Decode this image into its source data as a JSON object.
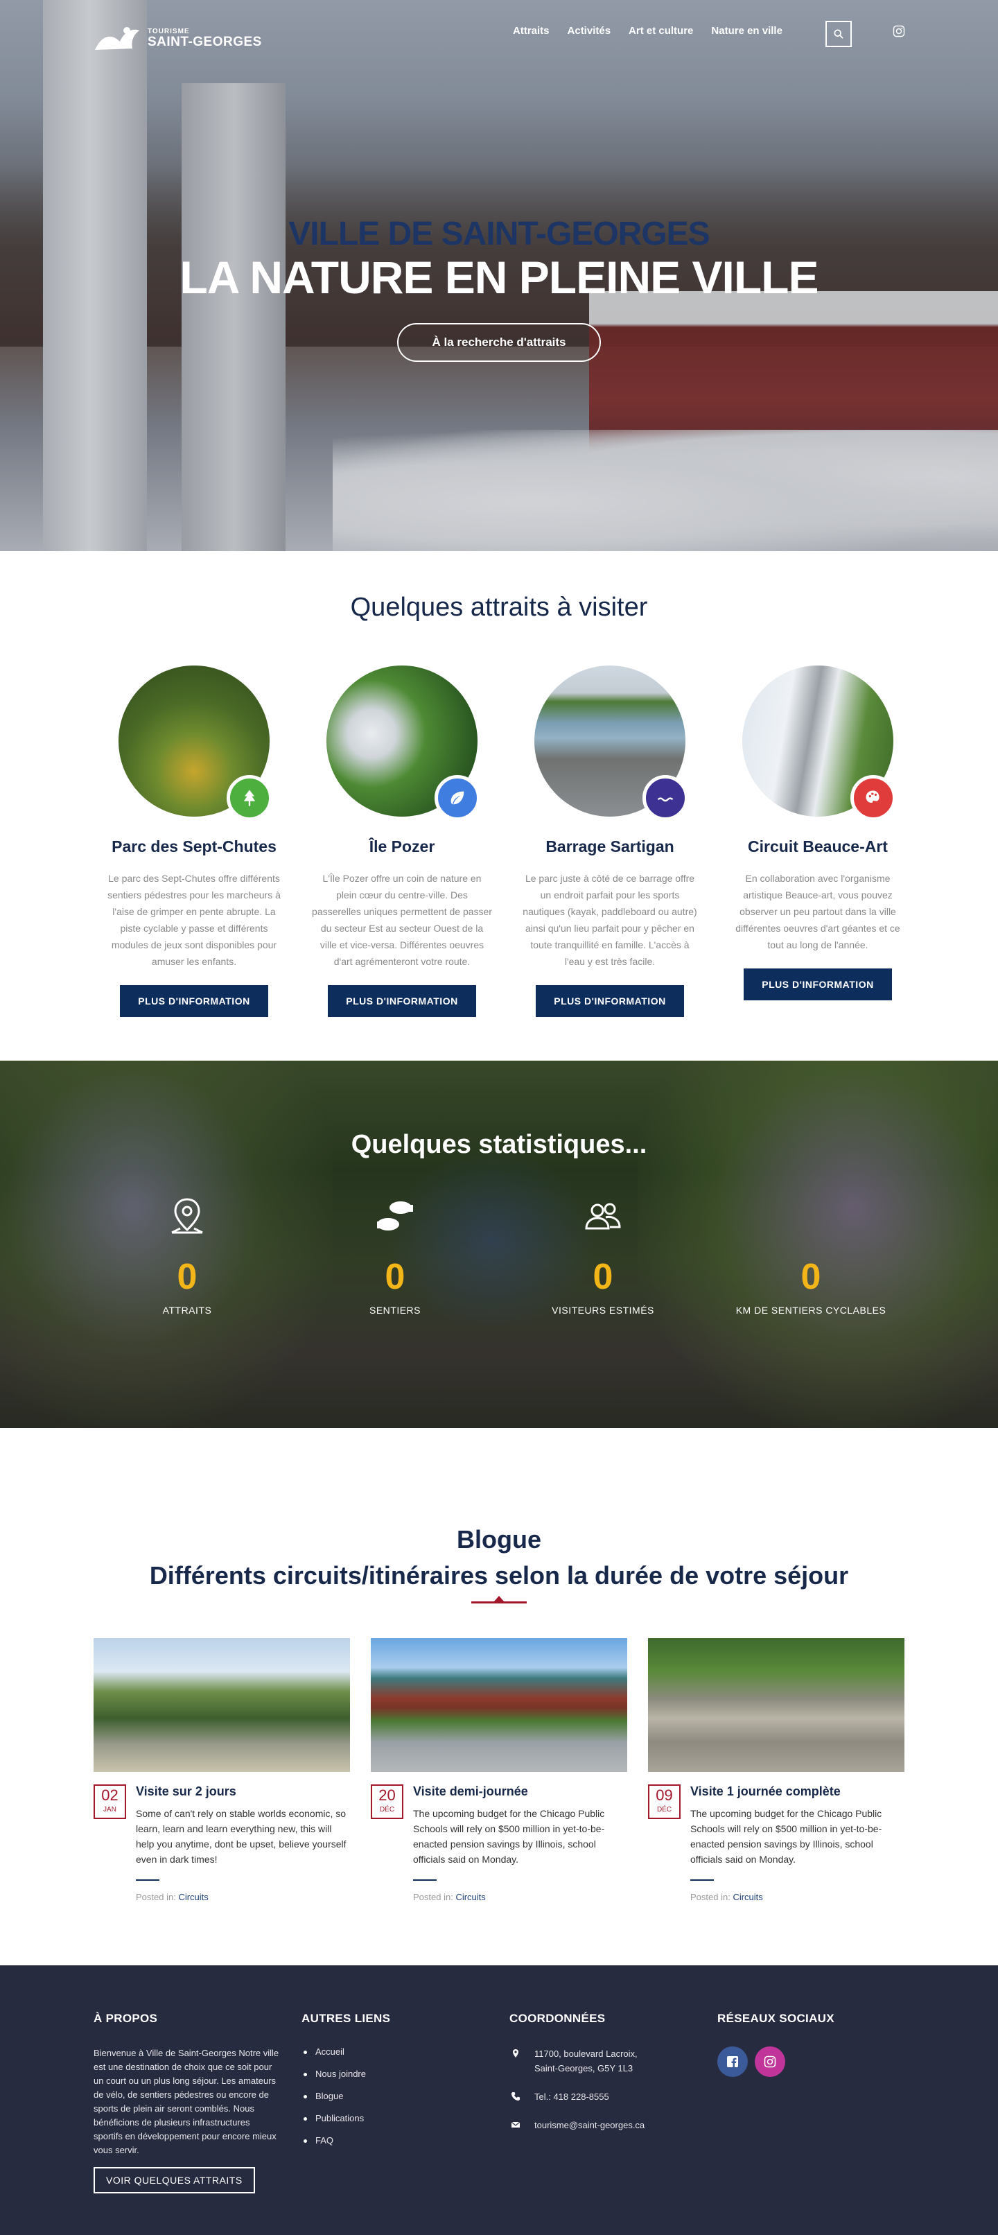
{
  "brand": {
    "top": "TOURISME",
    "name": "SAINT-GEORGES"
  },
  "nav": {
    "items": [
      "Attraits",
      "Activités",
      "Art et culture",
      "Nature en ville"
    ]
  },
  "hero": {
    "kicker": "VILLE DE SAINT-GEORGES",
    "title": "LA NATURE EN PLEINE VILLE",
    "cta": "À la recherche d'attraits"
  },
  "attractions": {
    "heading": "Quelques attraits à visiter",
    "button_label": "PLUS D'INFORMATION",
    "items": [
      {
        "title": "Parc des Sept-Chutes",
        "text": "Le parc des Sept-Chutes offre différents sentiers pédestres pour les marcheurs à l'aise de grimper en pente abrupte. La piste cyclable y passe et différents modules de jeux sont disponibles pour amuser les enfants.",
        "icon": "tree-icon",
        "badge_color": "#4caf3e"
      },
      {
        "title": "Île Pozer",
        "text": "L'Île Pozer offre un coin de nature en plein cœur du centre-ville. Des passerelles uniques permettent de passer du secteur Est au secteur Ouest de la ville et vice-versa. Différentes oeuvres d'art agrémenteront votre route.",
        "icon": "leaf-icon",
        "badge_color": "#3f7de0"
      },
      {
        "title": "Barrage Sartigan",
        "text": "Le parc juste à côté de ce barrage offre un endroit parfait pour les sports nautiques (kayak, paddleboard ou autre) ainsi qu'un lieu parfait pour y pêcher en toute tranquillité en famille. L'accès à l'eau y est très facile.",
        "icon": "water-icon",
        "badge_color": "#3d3193"
      },
      {
        "title": "Circuit Beauce-Art",
        "text": "En collaboration avec l'organisme artistique Beauce-art, vous pouvez observer un peu partout dans la ville différentes oeuvres d'art géantes et ce tout au long de l'année.",
        "icon": "palette-icon",
        "badge_color": "#e03c3c"
      }
    ]
  },
  "stats": {
    "heading": "Quelques statistiques...",
    "items": [
      {
        "value": "0",
        "label": "ATTRAITS",
        "icon": "map-pin-icon"
      },
      {
        "value": "0",
        "label": "SENTIERS",
        "icon": "footprints-icon"
      },
      {
        "value": "0",
        "label": "VISITEURS ESTIMÉS",
        "icon": "people-icon"
      },
      {
        "value": "0",
        "label": "KM DE SENTIERS CYCLABLES",
        "icon": "bike-icon"
      }
    ]
  },
  "blog": {
    "kicker": "Blogue",
    "title": "Différents circuits/itinéraires selon la durée de votre séjour",
    "posted_in": "Posted in:",
    "posts": [
      {
        "day": "02",
        "month": "JAN",
        "title": "Visite sur 2 jours",
        "text": "Some of can't rely on stable worlds economic, so learn, learn and learn everything new, this will help you anytime, dont be upset, believe yourself even in dark times!",
        "category": "Circuits"
      },
      {
        "day": "20",
        "month": "DÉC",
        "title": "Visite demi-journée",
        "text": "The upcoming budget for the Chicago Public Schools will rely on $500 million in yet-to-be-enacted pension savings by Illinois, school officials said on Monday.",
        "category": "Circuits"
      },
      {
        "day": "09",
        "month": "DÉC",
        "title": "Visite 1 journée complète",
        "text": "The upcoming budget for the Chicago Public Schools will rely on $500 million in yet-to-be-enacted pension savings by Illinois, school officials said on Monday.",
        "category": "Circuits"
      }
    ]
  },
  "footer": {
    "about": {
      "heading": "À PROPOS",
      "text": "Bienvenue à Ville de Saint-Georges Notre ville est une destination de choix que ce soit pour un court ou un plus long séjour. Les amateurs de vélo, de sentiers pédestres ou encore de sports de plein air seront comblés. Nous bénéficions de plusieurs infrastructures sportifs en développement pour encore mieux vous servir.",
      "button": "VOIR QUELQUES ATTRAITS"
    },
    "links": {
      "heading": "AUTRES LIENS",
      "items": [
        "Accueil",
        "Nous joindre",
        "Blogue",
        "Publications",
        "FAQ"
      ]
    },
    "contact": {
      "heading": "COORDONNÉES",
      "address_line1": "11700, boulevard Lacroix,",
      "address_line2": "Saint-Georges, G5Y 1L3",
      "phone": "Tel.: 418 228-8555",
      "email": "tourisme@saint-georges.ca"
    },
    "social": {
      "heading": "RÉSEAUX SOCIAUX",
      "facebook_color": "#3b5a9a",
      "instagram_color": "#c1359b"
    }
  }
}
